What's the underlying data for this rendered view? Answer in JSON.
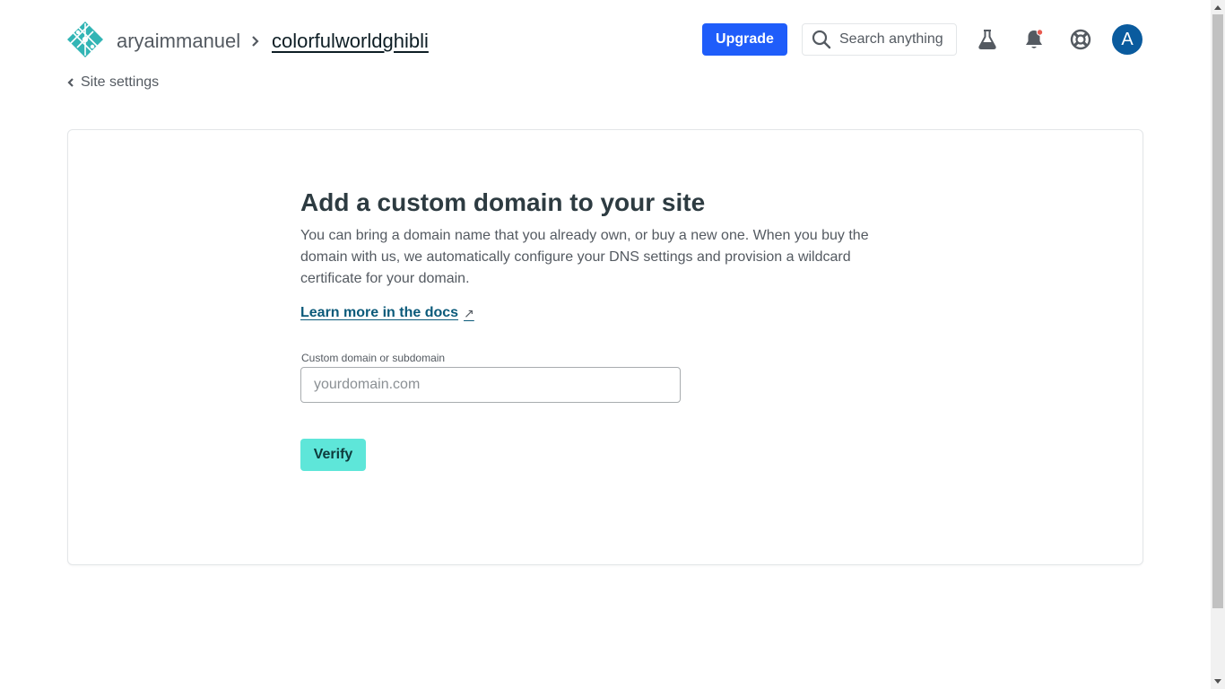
{
  "header": {
    "team_name": "aryaimmanuel",
    "site_name": "colorfulworldghibli",
    "upgrade_label": "Upgrade",
    "search_placeholder": "Search anything",
    "avatar_initial": "A",
    "icons": [
      "labs-flask-icon",
      "notifications-bell-icon",
      "support-lifebuoy-icon"
    ]
  },
  "back_link": {
    "label": "Site settings"
  },
  "card": {
    "title": "Add a custom domain to your site",
    "description": "You can bring a domain name that you already own, or buy a new one. When you buy the domain with us, we automatically configure your DNS settings and provision a wildcard certificate for your domain.",
    "docs_link": "Learn more in the docs",
    "docs_arrow": "↗",
    "field_label": "Custom domain or subdomain",
    "field_value": "",
    "field_placeholder": "yourdomain.com",
    "verify_label": "Verify"
  },
  "colors": {
    "brand_blue": "#1f5dfa",
    "verify_teal": "#5ee6d9",
    "logo_teal": "#32b5b5",
    "avatar_blue": "#0a5b9e",
    "notification_dot": "#e85a4f"
  }
}
